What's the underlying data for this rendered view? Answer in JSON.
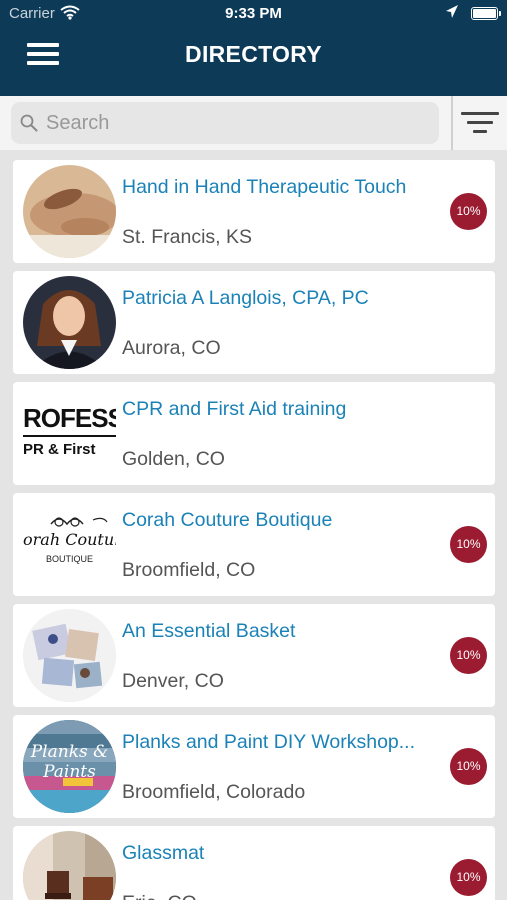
{
  "status_bar": {
    "carrier": "Carrier",
    "time": "9:33 PM"
  },
  "header": {
    "title": "DIRECTORY"
  },
  "search": {
    "placeholder": "Search",
    "value": ""
  },
  "listings": [
    {
      "name": "Hand in Hand Therapeutic Touch",
      "location": "St. Francis, KS",
      "badge": "10%"
    },
    {
      "name": "Patricia A Langlois, CPA, PC",
      "location": "Aurora, CO",
      "badge": ""
    },
    {
      "name": "CPR and First Aid training",
      "location": "Golden, CO",
      "badge": "",
      "logo_text": [
        "ROFESS",
        "PR & First"
      ]
    },
    {
      "name": "Corah Couture Boutique",
      "location": "Broomfield, CO",
      "badge": "10%",
      "logo_text": [
        "orah Couture",
        "BOUTIQUE"
      ]
    },
    {
      "name": "An Essential Basket",
      "location": "Denver, CO",
      "badge": "10%"
    },
    {
      "name": "Planks and Paint DIY Workshop...",
      "location": "Broomfield, Colorado",
      "badge": "10%",
      "logo_text": [
        "Planks &",
        "Paints"
      ]
    },
    {
      "name": "Glassmat",
      "location": "Erie, CO",
      "badge": "10%"
    }
  ],
  "colors": {
    "header_bg": "#0d3b57",
    "link": "#1b82b8",
    "badge": "#9b1b30"
  }
}
